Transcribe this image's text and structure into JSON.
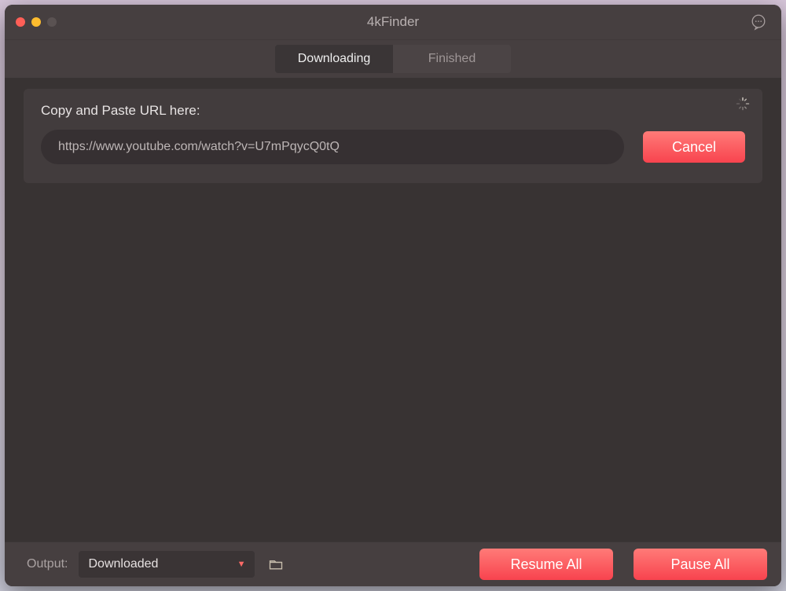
{
  "window": {
    "title": "4kFinder"
  },
  "tabs": {
    "downloading": "Downloading",
    "finished": "Finished",
    "active": "downloading"
  },
  "panel": {
    "label": "Copy and Paste URL here:",
    "url_value": "https://www.youtube.com/watch?v=U7mPqycQ0tQ",
    "cancel": "Cancel"
  },
  "footer": {
    "output_label": "Output:",
    "output_value": "Downloaded",
    "resume": "Resume All",
    "pause": "Pause All"
  },
  "colors": {
    "accent": "#f8434e"
  }
}
